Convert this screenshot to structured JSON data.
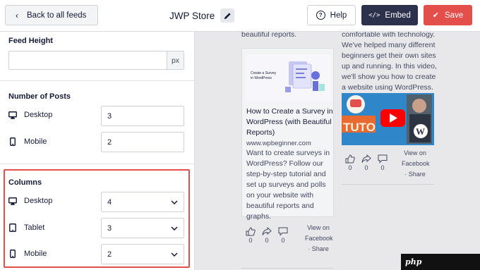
{
  "topbar": {
    "back_label": "Back to all feeds",
    "feed_title": "JWP Store",
    "help_label": "Help",
    "embed_label": "Embed",
    "save_label": "Save"
  },
  "sidebar": {
    "feed_height": {
      "label": "Feed Height",
      "value": "",
      "unit": "px"
    },
    "number_of_posts": {
      "label": "Number of Posts",
      "rows": [
        {
          "device": "Desktop",
          "value": "3"
        },
        {
          "device": "Mobile",
          "value": "2"
        }
      ]
    },
    "columns": {
      "label": "Columns",
      "rows": [
        {
          "device": "Desktop",
          "value": "4"
        },
        {
          "device": "Tablet",
          "value": "3"
        },
        {
          "device": "Mobile",
          "value": "2"
        }
      ]
    }
  },
  "preview": {
    "col1_top_text": "beautiful reports.",
    "col2_lines": [
      "comfortable with technology.",
      "We've helped many different",
      "beginners get their own sites",
      "up and running. In this video,",
      "we'll show you how to create",
      "a website using WordPress."
    ],
    "post": {
      "thumb_line1": "Create a Survey",
      "thumb_line2": "in WordPress",
      "title_lines": [
        "How to Create a Survey in",
        "WordPress (with Beautiful",
        "Reports)"
      ],
      "domain": "www.wpbeginner.com",
      "desc_lines": [
        "Want to create surveys in",
        "WordPress? Follow our",
        "step-by-step tutorial and",
        "set up surveys and polls",
        "on your website with",
        "beautiful reports and",
        "graphs."
      ]
    },
    "video_text": "TUTO",
    "reactions": {
      "likes": "0",
      "shares": "0",
      "comments": "0"
    },
    "view_on": "View on",
    "facebook": "Facebook",
    "share": "· Share"
  },
  "watermark": "php",
  "colors": {
    "accent": "#e34f4a",
    "embed": "#2c324c",
    "text": "#141b38"
  }
}
